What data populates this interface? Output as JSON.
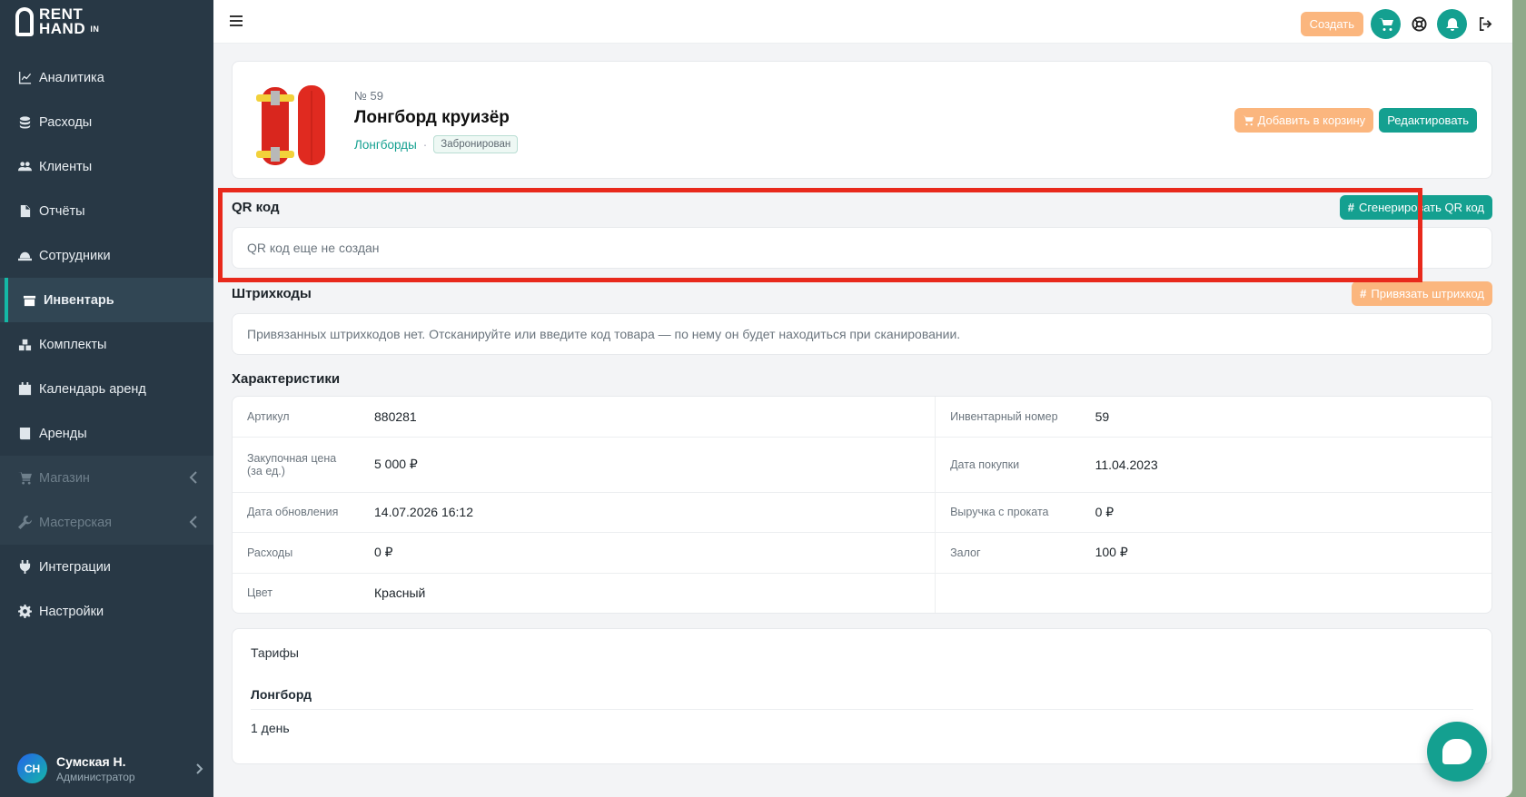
{
  "brand": {
    "line1": "RENT",
    "line2": "HAND",
    "in": "IN"
  },
  "nav": [
    {
      "label": "Аналитика",
      "icon": "chart-icon"
    },
    {
      "label": "Расходы",
      "icon": "coins-icon"
    },
    {
      "label": "Клиенты",
      "icon": "users-icon"
    },
    {
      "label": "Отчёты",
      "icon": "file-icon"
    },
    {
      "label": "Сотрудники",
      "icon": "hard-hat-icon"
    },
    {
      "label": "Инвентарь",
      "icon": "box-icon",
      "active": true
    },
    {
      "label": "Комплекты",
      "icon": "boxes-icon"
    },
    {
      "label": "Календарь аренд",
      "icon": "calendar-icon"
    },
    {
      "label": "Аренды",
      "icon": "book-icon"
    },
    {
      "label": "Магазин",
      "icon": "cart-icon",
      "muted": true
    },
    {
      "label": "Мастерская",
      "icon": "wrench-icon",
      "muted": true
    },
    {
      "label": "Интеграции",
      "icon": "plug-icon"
    },
    {
      "label": "Настройки",
      "icon": "gear-icon"
    }
  ],
  "user": {
    "initials": "СН",
    "name": "Сумская Н.",
    "role": "Администратор"
  },
  "topbar": {
    "create_label": "Создать"
  },
  "product": {
    "number": "№ 59",
    "title": "Лонгборд круизёр",
    "category": "Лонгборды",
    "separator": "·",
    "status": "Забронирован",
    "add_to_cart": "Добавить в корзину",
    "edit": "Редактировать"
  },
  "qr": {
    "title": "QR код",
    "generate": "Сгенерировать QR код",
    "empty": "QR код еще не создан"
  },
  "barcodes": {
    "title": "Штрихкоды",
    "bind": "Привязать штрихкод",
    "empty": "Привязанных штрихкодов нет. Отсканируйте или введите код товара — по нему он будет находиться при сканировании."
  },
  "characteristics": {
    "title": "Характеристики",
    "rows": [
      {
        "k1": "Артикул",
        "v1": "880281",
        "k2": "Инвентарный номер",
        "v2": "59"
      },
      {
        "k1": "Закупочная цена (за ед.)",
        "v1": "5 000 ₽",
        "k2": "Дата покупки",
        "v2": "11.04.2023"
      },
      {
        "k1": "Дата обновления",
        "v1": "14.07.2026 16:12",
        "k2": "Выручка с проката",
        "v2": "0 ₽"
      },
      {
        "k1": "Расходы",
        "v1": "0 ₽",
        "k2": "Залог",
        "v2": "100 ₽"
      },
      {
        "k1": "Цвет",
        "v1": "Красный",
        "k2": "",
        "v2": ""
      }
    ]
  },
  "tariffs": {
    "title": "Тарифы",
    "name": "Лонгборд",
    "duration": "1 день"
  },
  "colors": {
    "sidebar": "#283845",
    "teal": "#14a090",
    "orange": "#fbb67e",
    "highlight": "#e8291c"
  }
}
